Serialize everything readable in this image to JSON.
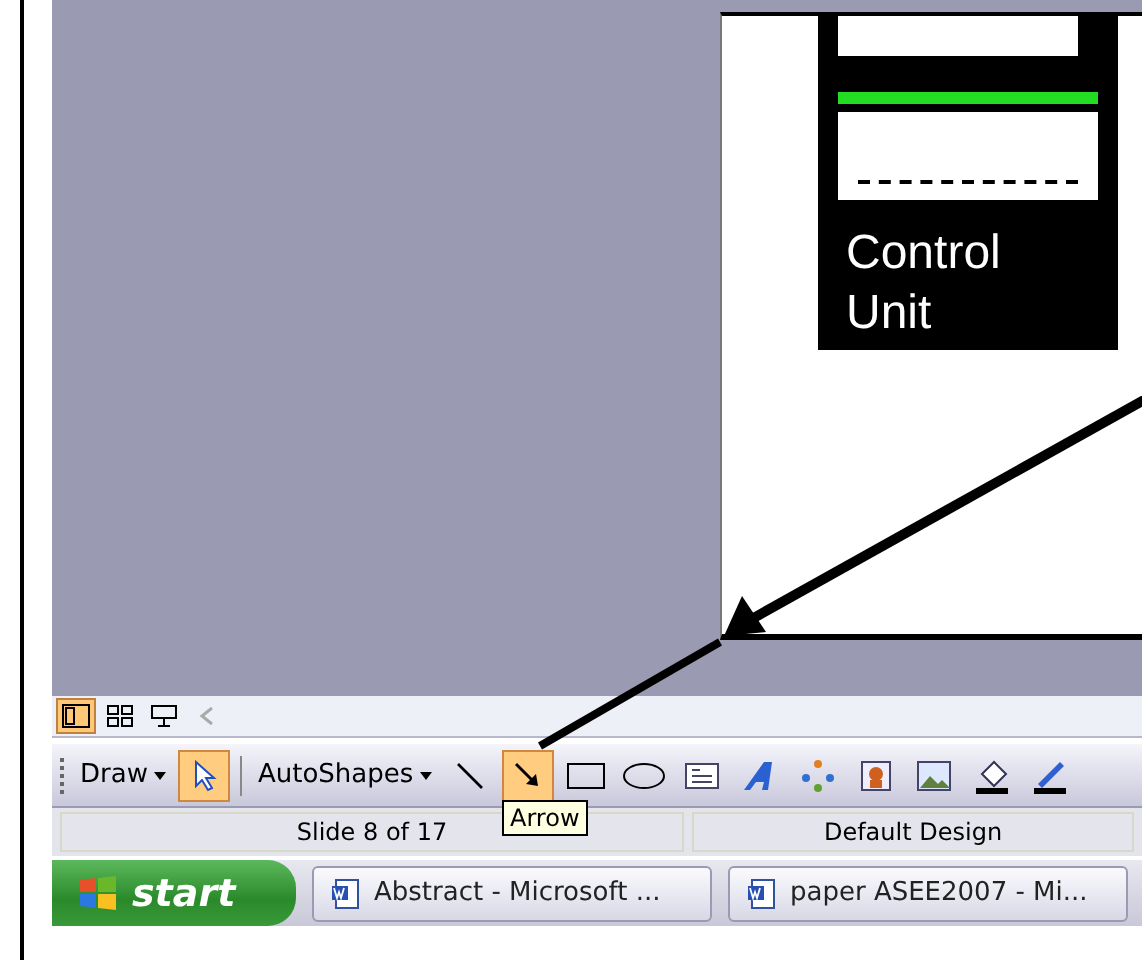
{
  "slide": {
    "label_lines": [
      "Control",
      "Unit"
    ]
  },
  "view_buttons": [
    {
      "kind": "normal",
      "selected": true
    },
    {
      "kind": "sorter",
      "selected": false
    },
    {
      "kind": "show",
      "selected": false
    },
    {
      "kind": "back",
      "selected": false
    }
  ],
  "toolbar": {
    "draw_menu": "Draw",
    "autoshapes_menu": "AutoShapes",
    "tools": [
      {
        "kind": "select",
        "selected": true
      },
      {
        "kind": "line",
        "selected": false
      },
      {
        "kind": "arrow",
        "selected": true
      },
      {
        "kind": "rectangle",
        "selected": false
      },
      {
        "kind": "oval",
        "selected": false
      },
      {
        "kind": "textbox",
        "selected": false
      },
      {
        "kind": "wordart",
        "selected": false
      },
      {
        "kind": "diagram",
        "selected": false
      },
      {
        "kind": "clipart",
        "selected": false
      },
      {
        "kind": "picture",
        "selected": false
      },
      {
        "kind": "fill",
        "selected": false
      },
      {
        "kind": "pen",
        "selected": false
      }
    ],
    "tooltip": "Arrow"
  },
  "status_bar": [
    "Slide 8 of 17",
    "Default Design"
  ],
  "taskbar": {
    "start": "start",
    "tasks": [
      {
        "label": "Abstract - Microsoft ..."
      },
      {
        "label": "paper ASEE2007 - Mi..."
      }
    ]
  }
}
